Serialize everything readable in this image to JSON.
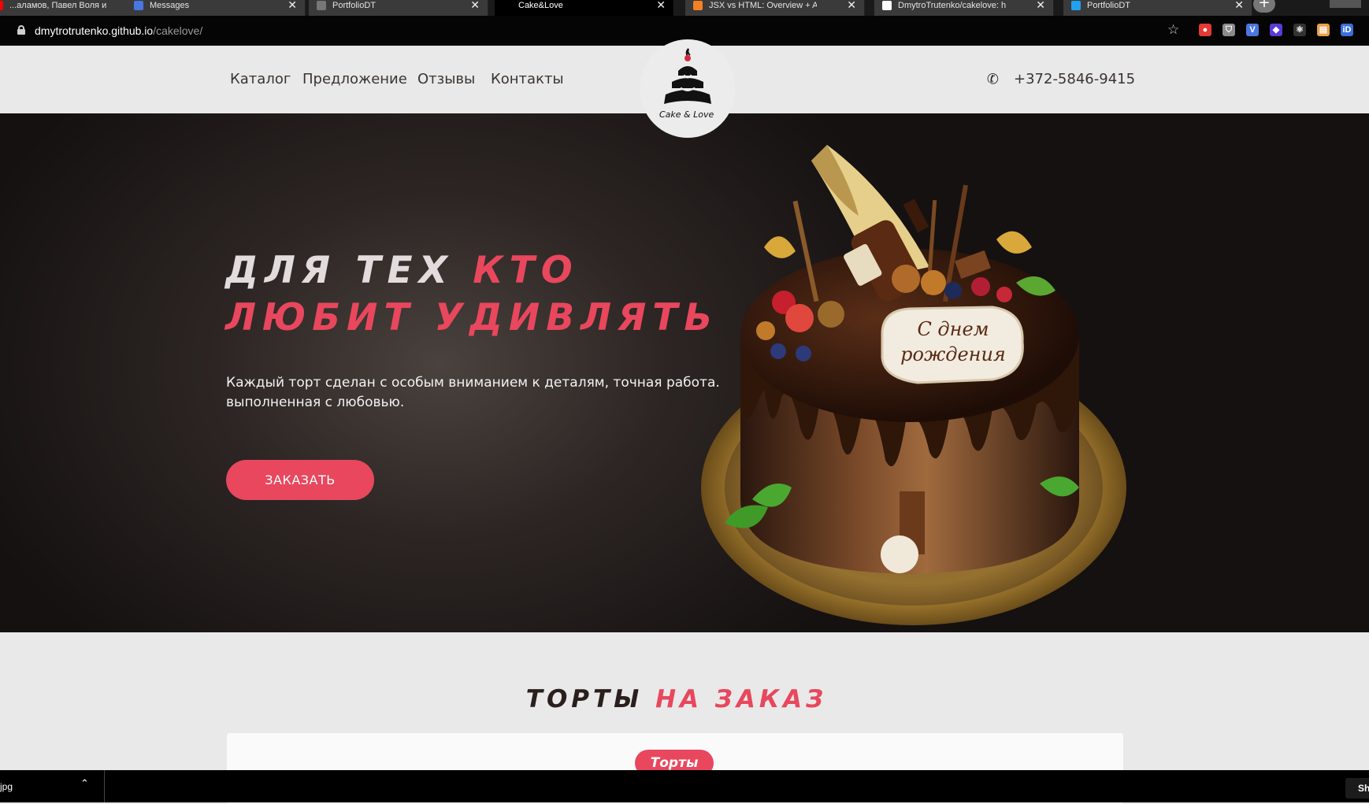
{
  "browser": {
    "tabs": [
      {
        "title": "...аламов, Павел Воля и",
        "icon": "youtube-icon",
        "icon_color": "#ff0000",
        "active": false
      },
      {
        "title": "Messages",
        "icon": "chat-icon",
        "icon_color": "#4a76e0",
        "active": false
      },
      {
        "title": "PortfolioDT",
        "icon": "globe-icon",
        "icon_color": "#777777",
        "active": false
      },
      {
        "title": "Cake&Love",
        "icon": "",
        "icon_color": "",
        "active": true
      },
      {
        "title": "JSX vs HTML: Overview + Answe",
        "icon": "stackoverflow-icon",
        "icon_color": "#f48024",
        "active": false
      },
      {
        "title": "DmytroTrutenko/cakelove: html",
        "icon": "github-icon",
        "icon_color": "#ffffff",
        "active": false
      },
      {
        "title": "PortfolioDT",
        "icon": "webstorm-icon",
        "icon_color": "#22a1f0",
        "active": false
      }
    ],
    "new_tab_label": "+",
    "minimize_label": "–",
    "url_host": "dmytrotrutenko.github.io",
    "url_path": "/cakelove/",
    "extensions": [
      {
        "name": "adblock-icon",
        "color": "#e53935",
        "glyph": "●"
      },
      {
        "name": "shield-icon",
        "color": "#8a8a8a",
        "glyph": "⛉"
      },
      {
        "name": "vk-extension-icon",
        "color": "#4a76e0",
        "glyph": "V"
      },
      {
        "name": "vpn-icon",
        "color": "#5b3bd6",
        "glyph": "◆"
      },
      {
        "name": "react-devtools-icon",
        "color": "#333333",
        "glyph": "⚛"
      },
      {
        "name": "folder-extension-icon",
        "color": "#e8a04a",
        "glyph": "▤"
      },
      {
        "name": "id-extension-icon",
        "color": "#3a6fd8",
        "glyph": "iD"
      }
    ]
  },
  "site": {
    "nav": [
      "Каталог",
      "Предложение",
      "Отзывы",
      "Контакты"
    ],
    "logo_text": "Cake & Love",
    "phone": "+372-5846-9415",
    "accent_color": "#e8475d",
    "hero": {
      "title_line1_plain": "ДЛЯ ТЕХ ",
      "title_line1_accent": "КТО",
      "title_line2_accent": "ЛЮБИТ УДИВЛЯТЬ",
      "description": "Каждый торт сделан с особым вниманием к деталям, точная работа. выполненная с любовью.",
      "button_label": "ЗАКАЗАТЬ",
      "plaque_text_line1": "С днем",
      "plaque_text_line2": "рождения"
    },
    "catalog": {
      "title_plain": "ТОРТЫ ",
      "title_accent": "НА ЗАКАЗ",
      "active_tab": "Торты"
    }
  },
  "taskbar": {
    "download_name": "jpg",
    "show_all_label": "Sh"
  }
}
